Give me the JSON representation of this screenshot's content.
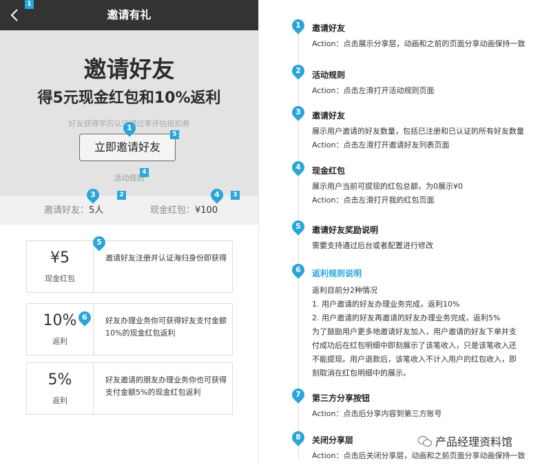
{
  "phone": {
    "title": "邀请有礼",
    "hero_title": "邀请好友",
    "hero_subtitle": "得5元现金红包和10%返利",
    "hero_desc": "好友获得学历认证通过率评估抵扣券",
    "invite_button": "立即邀请好友",
    "rules_link": "活动规则",
    "stats": {
      "friends_label": "邀请好友：",
      "friends_value": "5人",
      "cash_label": "现金红包：",
      "cash_value": "¥100"
    },
    "cards": [
      {
        "amount": "¥5",
        "label": "现金红包",
        "text": "邀请好友注册并认证海归身份即获得"
      },
      {
        "amount": "10%",
        "label": "返利",
        "text": "好友办理业务你可获得好友支付金额10%的现金红包返利"
      },
      {
        "amount": "5%",
        "label": "返利",
        "text": "好友邀请的朋友办理业务你也可获得支付金额5%的现金红包返利"
      }
    ]
  },
  "annotations": {
    "pins": [
      "1",
      "2",
      "3",
      "4",
      "5",
      "6",
      "7",
      "8"
    ],
    "squares": [
      "1",
      "2",
      "3",
      "4",
      "5"
    ]
  },
  "spec": {
    "items": [
      {
        "num": "1",
        "title": "邀请好友",
        "lines": [
          "Action：点击展示分享层，动画和之前的页面分享动画保持一致"
        ]
      },
      {
        "num": "2",
        "title": "活动规则",
        "lines": [
          "Action：点击左滑打开活动规则页面"
        ]
      },
      {
        "num": "3",
        "title": "邀请好友",
        "lines": [
          "展示用户邀请的好友数量，包括已注册和已认证的所有好友数量",
          "Action：点击左滑打开邀请好友列表页面"
        ]
      },
      {
        "num": "4",
        "title": "现金红包",
        "lines": [
          "展示用户当前可提现的红包总额，为0展示¥0",
          "Action：点击左滑打开我的红包页面"
        ]
      },
      {
        "num": "5",
        "title": "邀请好友奖励说明",
        "lines": [
          "需要支持通过后台或者配置进行修改"
        ]
      },
      {
        "num": "6",
        "title": "返利规则说明",
        "lines": [
          "返利目前分2种情况",
          "1. 用户邀请的好友办理业务完成，返利10%",
          "2. 用户邀请的好友再邀请的好友办理业务完成，返利5%",
          "为了鼓励用户更多地邀请好友加入，用户邀请的好友下单并支",
          "付成功后在红包明细中即刻展示了该笔收入，只是该笔收入还",
          "不能提现。用户退款后，该笔收入不计入用户的红包收入，即",
          "刻取消在红包明细中的展示。"
        ]
      },
      {
        "num": "7",
        "title": "第三方分享按钮",
        "lines": [
          "Action：点击后分享内容到第三方账号"
        ]
      },
      {
        "num": "8",
        "title": "关闭分享层",
        "lines": [
          "Action：点击后关闭分享层，动画和之前页面分享动画保持一致"
        ]
      }
    ]
  },
  "watermark": "产品经理资料馆",
  "colors": {
    "accent": "#2aa5d8",
    "navbar": "#333333",
    "hero_bg": "#e3e3e3"
  }
}
